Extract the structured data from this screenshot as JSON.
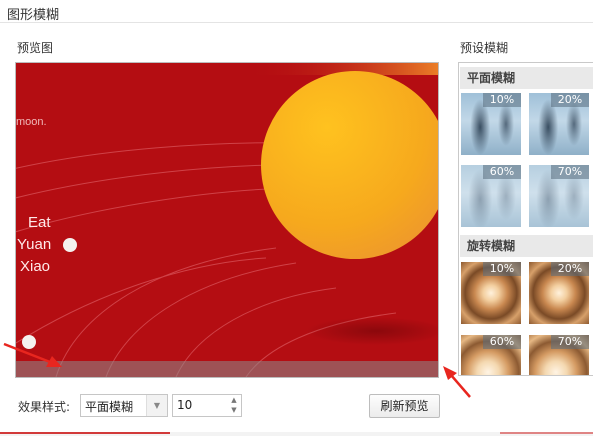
{
  "window": {
    "title": "图形模糊"
  },
  "preview": {
    "label": "预览图",
    "image": {
      "text_top": "moon.",
      "text_lines": [
        "Eat",
        "Yuan",
        "Xiao"
      ]
    }
  },
  "presets": {
    "label": "预设模糊",
    "sections": [
      {
        "title": "平面模糊",
        "items": [
          {
            "percent": "10%"
          },
          {
            "percent": "20%"
          },
          {
            "percent": "60%"
          },
          {
            "percent": "70%"
          }
        ]
      },
      {
        "title": "旋转模糊",
        "items": [
          {
            "percent": "10%"
          },
          {
            "percent": "20%"
          },
          {
            "percent": "60%"
          },
          {
            "percent": "70%"
          }
        ]
      }
    ]
  },
  "controls": {
    "style_label": "效果样式:",
    "style_value": "平面模糊",
    "amount_value": "10",
    "refresh_label": "刷新预览"
  },
  "colors": {
    "red_background": "#b40d12",
    "moon_yellow": "#f7b21a",
    "annotation_arrow": "#e8261f"
  },
  "icons": {
    "dropdown": "chevron-down-icon",
    "spin_up": "caret-up-icon",
    "spin_down": "caret-down-icon",
    "annotation": "arrow-icon"
  }
}
